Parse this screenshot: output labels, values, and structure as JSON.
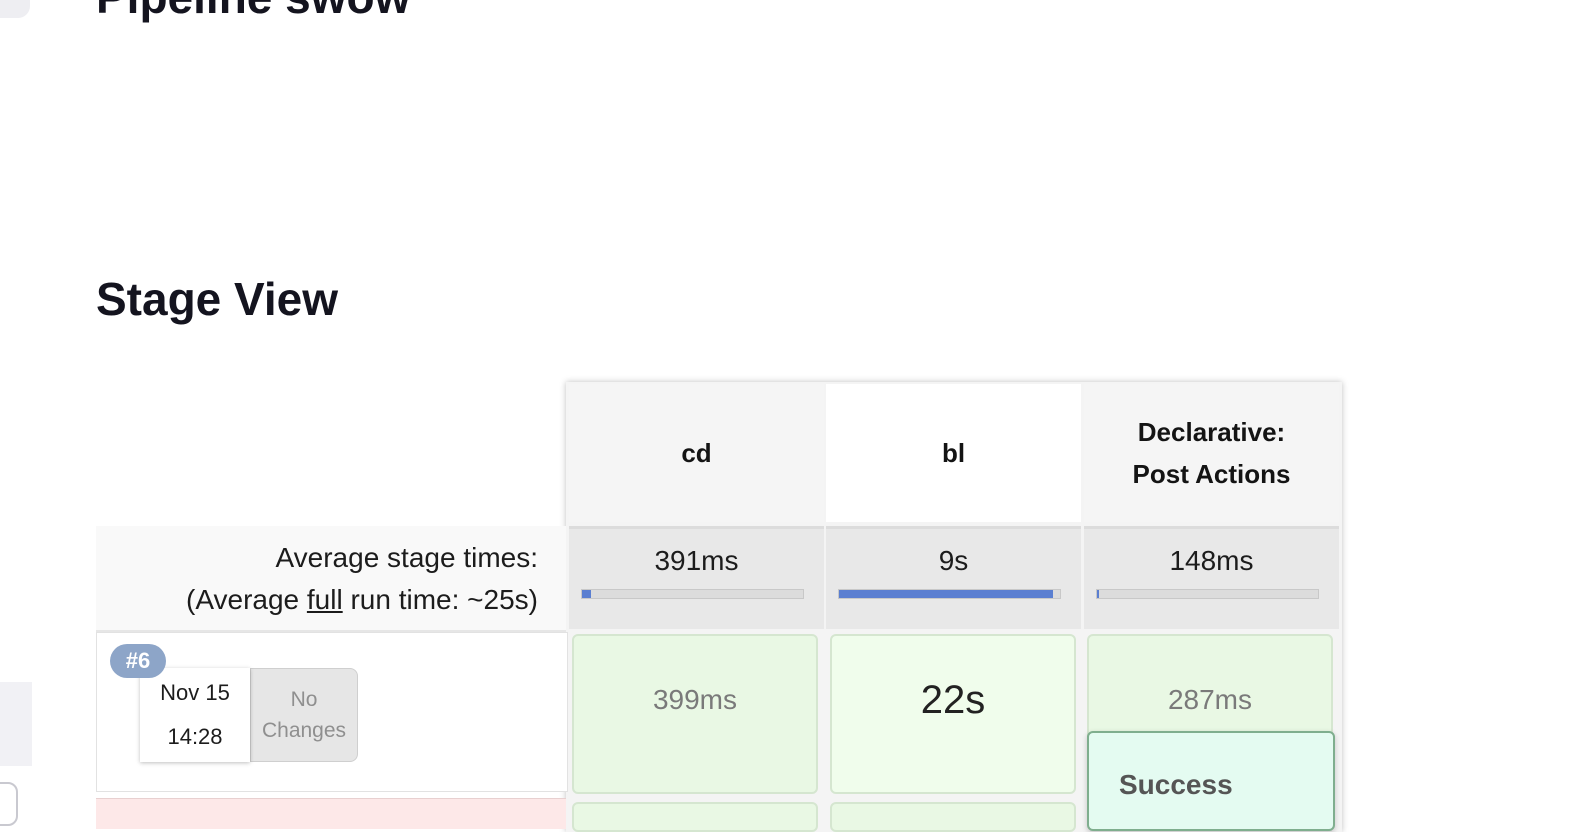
{
  "page": {
    "title": "Pipeline swow",
    "section_title": "Stage View"
  },
  "stage_view": {
    "columns": [
      {
        "name": "cd",
        "avg": "391ms",
        "bar_fraction": 0.04
      },
      {
        "name": "bl",
        "avg": "9s",
        "bar_fraction": 0.97
      },
      {
        "name": "Declarative: Post Actions",
        "name_line1": "Declarative:",
        "name_line2": "Post Actions",
        "avg": "148ms",
        "bar_fraction": 0.01
      }
    ],
    "avg_label": "Average stage times:",
    "avg_full_prefix": "(Average ",
    "avg_full_link": "full",
    "avg_full_suffix": " run time: ~25s)",
    "runs": [
      {
        "badge": "#6",
        "date": "Nov 15",
        "time": "14:28",
        "changes": "No Changes",
        "changes_line1": "No",
        "changes_line2": "Changes",
        "stage_times": [
          "399ms",
          "22s",
          "287ms"
        ]
      }
    ],
    "tooltip": "Success"
  },
  "colors": {
    "success_cell": "#e9f8e4",
    "bar_fill": "#5b7fd1",
    "badge": "#8da5c8",
    "failed_row": "#fde8e8"
  }
}
